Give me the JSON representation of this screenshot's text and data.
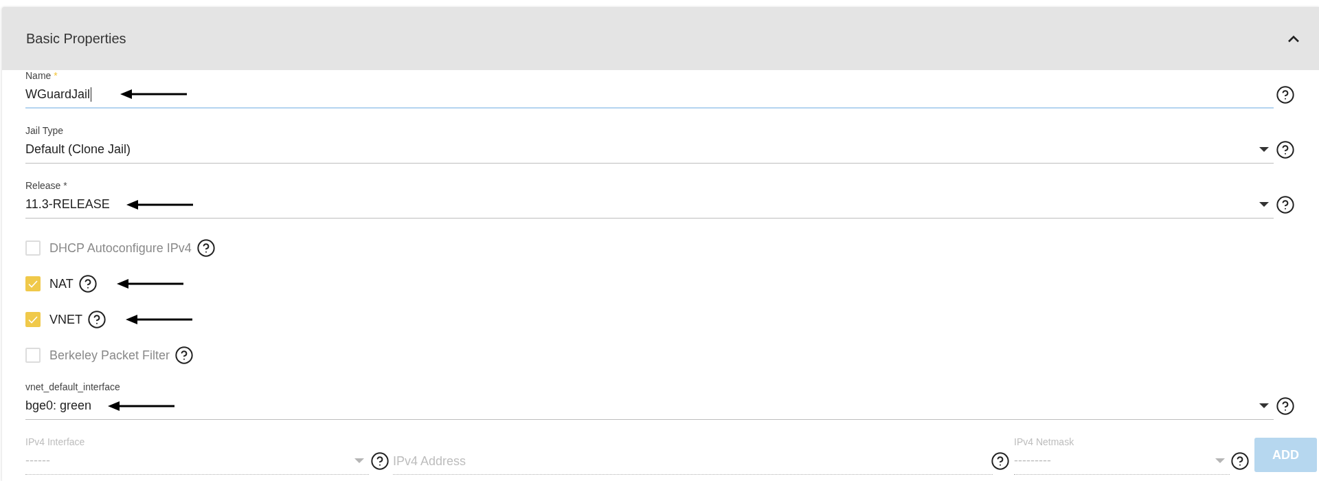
{
  "panel": {
    "title": "Basic Properties",
    "expanded": true
  },
  "fields": [
    {
      "kind": "text",
      "label": "Name",
      "required_mark": "*",
      "value": "WGuardJail",
      "focused": true,
      "arrow": true
    },
    {
      "kind": "select",
      "label": "Jail Type",
      "value": "Default (Clone Jail)",
      "focused": false,
      "arrow": false
    },
    {
      "kind": "select",
      "label": "Release",
      "required_mark": "*",
      "value": "11.3-RELEASE",
      "focused": false,
      "arrow": true
    },
    {
      "kind": "checkbox",
      "label": "DHCP Autoconfigure IPv4",
      "checked": false,
      "arrow": false
    },
    {
      "kind": "checkbox",
      "label": "NAT",
      "checked": true,
      "arrow": true
    },
    {
      "kind": "checkbox",
      "label": "VNET",
      "checked": true,
      "arrow": true
    },
    {
      "kind": "checkbox",
      "label": "Berkeley Packet Filter",
      "checked": false,
      "arrow": false
    },
    {
      "kind": "select",
      "label": "vnet_default_interface",
      "value": "bge0: green",
      "focused": false,
      "arrow": true
    }
  ],
  "ipv4_row": {
    "interface": {
      "label": "IPv4 Interface",
      "value": "------",
      "disabled": true
    },
    "address": {
      "placeholder": "IPv4 Address",
      "disabled": true
    },
    "netmask": {
      "label": "IPv4 Netmask",
      "value": "---------",
      "disabled": true
    },
    "add_button": {
      "label": "ADD",
      "disabled": true
    }
  }
}
